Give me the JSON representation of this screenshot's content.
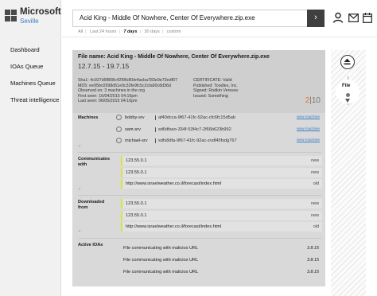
{
  "brand": {
    "name": "Microsoft",
    "product": "Seville"
  },
  "nav": [
    {
      "label": "Dashboard"
    },
    {
      "label": "IOAs Queue"
    },
    {
      "label": "Machines Queue"
    },
    {
      "label": "Threat intelligence"
    }
  ],
  "search": {
    "query": "Acid King - Middle Of Nowhere, Center Of Everywhere.zip.exe"
  },
  "filters": [
    "All",
    "Last 24 hours",
    "7 days",
    "30 days",
    "custom"
  ],
  "active_filter": "7 days",
  "file": {
    "name_label": "File name:",
    "name": "Acid King - Middle Of Nowhere, Center Of Everywhere.zip.exe",
    "date_range": "12.7.15 - 19.7.15",
    "meta_left": [
      "Sha1: 4c927d5f808c42f95d50e4acba783e9e73edf07",
      "MD5: ee95bc0598d51e0c32fe9fc5c2cfa90c8d36d",
      "Observed on: 3 machines in the org",
      "First seen: 16/04/2015 04:16pm",
      "Last seen: 06/05/2015 04:16pm"
    ],
    "meta_right": [
      "CERTIFICATE: Valid",
      "Published: Toodles, Inc.",
      "Signed: Rodkin Veresev",
      "Issued: Something"
    ],
    "score_a": "2",
    "score_sep": "|",
    "score_b": "10"
  },
  "machines": {
    "label": "Machines",
    "link_label": "view machine",
    "rows": [
      {
        "name": "bobby-srv",
        "id": "af40dcca-9f67-41fc-92ac-cfc6fc15d5ab"
      },
      {
        "name": "sam-srv",
        "id": "sd6dfaso-334f-53f4c7-2f66b623b992"
      },
      {
        "name": "michael-srv",
        "id": "sdfs8dfa-9f67-41fc-92ac-zvdf45fsdg767"
      }
    ]
  },
  "communicates": {
    "label": "Communicates with",
    "rows": [
      {
        "target": "123.55.0.1",
        "status": "new"
      },
      {
        "target": "123.55.0.1",
        "status": "new"
      },
      {
        "target": "http://www.israelweather.co.il/forecast/index.html",
        "status": "old"
      }
    ]
  },
  "downloaded": {
    "label": "Downloaded from",
    "rows": [
      {
        "target": "123.55.0.1",
        "status": "new"
      },
      {
        "target": "123.55.0.1",
        "status": "new"
      },
      {
        "target": "http://www.israelweather.co.il/forecast/index.html",
        "status": "old"
      }
    ]
  },
  "ioas": {
    "label": "Active IOAs",
    "rows": [
      {
        "text": "File communicating with malicios URL",
        "date": "3.8.15"
      },
      {
        "text": "File communicating with malicios URL",
        "date": "3.8.15"
      },
      {
        "text": "File communicating with malicios URL",
        "date": "3.8.15"
      }
    ]
  },
  "timeline": {
    "node_label": "File"
  }
}
